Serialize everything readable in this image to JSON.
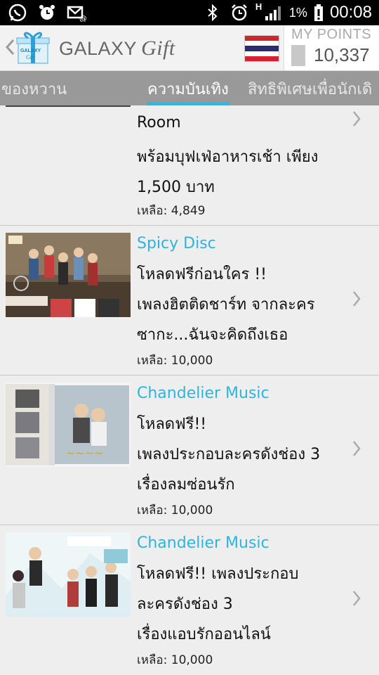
{
  "status_bar": {
    "battery": "1%",
    "time": "00:08",
    "signal_label": "H"
  },
  "header": {
    "brand_prefix": "GALAXY",
    "brand_suffix": "Gift",
    "logo_text_1": "GALAXY",
    "logo_text_2": "Gift",
    "points_label": "MY POINTS",
    "points_value": "10,337"
  },
  "tabs": [
    {
      "label": "ของหวาน"
    },
    {
      "label": "ความบันเทิง"
    },
    {
      "label": "สิทธิพิเศษเพื่อนักเดิ"
    }
  ],
  "items": [
    {
      "lines": [
        "Room",
        "พร้อมบุฟเฟ่อาหารเช้า เพียง",
        "1,500 บาท"
      ],
      "remain": "เหลือ: 4,849"
    },
    {
      "brand": "Spicy Disc",
      "lines": [
        "โหลดฟรีก่อนใคร !!",
        "เพลงฮิตติดชาร์ท จากละคร",
        "ซากะ...ฉันจะคิดถึงเธอ"
      ],
      "remain": "เหลือ: 10,000"
    },
    {
      "brand": "Chandelier Music",
      "lines": [
        "โหลดฟรี!!",
        "เพลงประกอบละครดังช่อง 3",
        "เรื่องลมซ่อนรัก"
      ],
      "remain": "เหลือ: 10,000"
    },
    {
      "brand": "Chandelier Music",
      "lines": [
        "โหลดฟรี!! เพลงประกอบ",
        "ละครดังช่อง 3",
        "เรื่องแอบรักออนไลน์"
      ],
      "remain": "เหลือ: 10,000"
    }
  ],
  "colors": {
    "accent": "#2fb6e3",
    "brand_text": "#2db5dd",
    "tab_bar": "#999999",
    "background": "#eeeeee"
  }
}
